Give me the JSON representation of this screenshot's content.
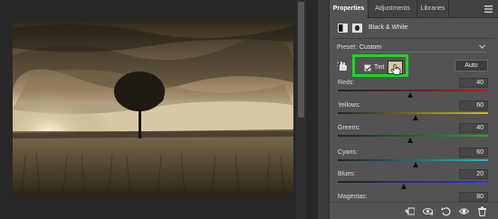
{
  "tabs": [
    {
      "label": "Properties",
      "active": true
    },
    {
      "label": "Adjustments",
      "active": false
    },
    {
      "label": "Libraries",
      "active": false
    }
  ],
  "adjustment": {
    "title": "Black & White",
    "icons": [
      "adjustment-layer-icon",
      "mask-icon"
    ]
  },
  "preset": {
    "label": "Preset:",
    "value": "Custom"
  },
  "tint": {
    "label": "Tint",
    "checked": true,
    "swatch_color": "#d9c7a4",
    "highlight_color": "#19d719"
  },
  "auto_label": "Auto",
  "sliders": [
    {
      "label": "Reds:",
      "value": "40",
      "min": -200,
      "max": 300,
      "color": "#b81d1d"
    },
    {
      "label": "Yellows:",
      "value": "60",
      "min": -200,
      "max": 300,
      "color": "#c7c22b"
    },
    {
      "label": "Greens:",
      "value": "40",
      "min": -200,
      "max": 300,
      "color": "#27a82a"
    },
    {
      "label": "Cyans:",
      "value": "60",
      "min": -200,
      "max": 300,
      "color": "#1fb9c6"
    },
    {
      "label": "Blues:",
      "value": "20",
      "min": -200,
      "max": 300,
      "color": "#2a36d4"
    },
    {
      "label": "Magentas:",
      "value": "80",
      "min": -200,
      "max": 300,
      "color": "#b326b9"
    }
  ],
  "bottom_icons": [
    "clip-to-layer-icon",
    "view-previous-state-icon",
    "reset-icon",
    "visibility-eye-icon",
    "delete-trash-icon"
  ],
  "colors": {
    "panel_bg": "#535353",
    "canvas_bg": "#282828",
    "image_tone": "#a89270"
  }
}
